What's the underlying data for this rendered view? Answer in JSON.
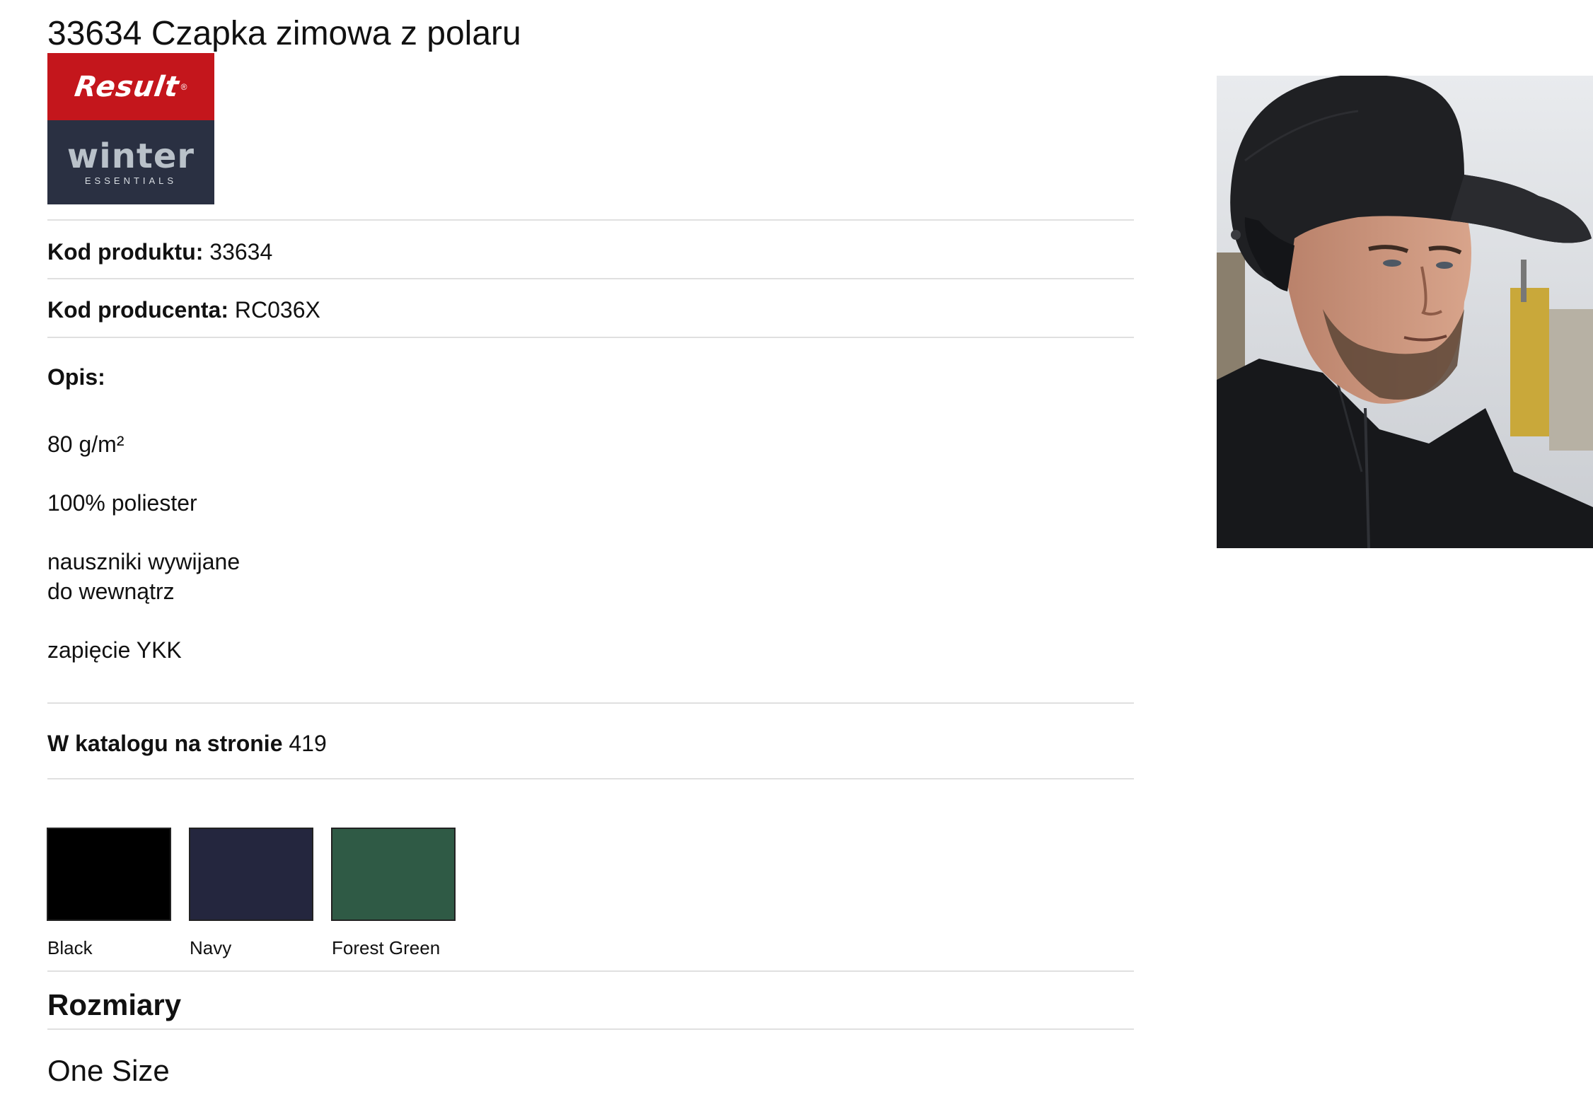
{
  "product": {
    "title": "33634 Czapka zimowa z polaru",
    "code_label": "Kod produktu:",
    "code_value": "33634",
    "mfr_label": "Kod producenta:",
    "mfr_value": "RC036X",
    "desc_label": "Opis:",
    "desc_lines": [
      "80 g/m²",
      "100% poliester",
      "nauszniki wywijane",
      "do wewnątrz",
      "zapięcie YKK"
    ],
    "catalog_label": "W katalogu na stronie",
    "catalog_value": "419"
  },
  "brand": {
    "name": "Result",
    "line": "winter",
    "subline": "ESSENTIALS",
    "colors": {
      "top": "#c4161c",
      "bottom": "#2a3042"
    }
  },
  "colors": [
    {
      "name": "Black",
      "hex": "#000000"
    },
    {
      "name": "Navy",
      "hex": "#24263e"
    },
    {
      "name": "Forest Green",
      "hex": "#2f5a45"
    }
  ],
  "sizes": {
    "heading": "Rozmiary",
    "values": [
      "One Size"
    ]
  }
}
